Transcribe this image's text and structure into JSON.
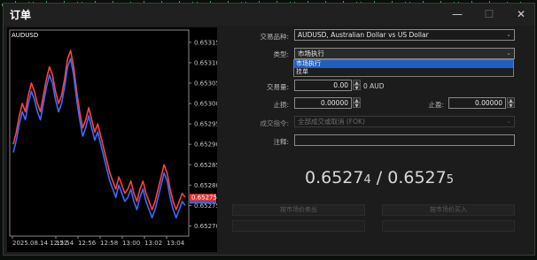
{
  "window": {
    "title": "订单",
    "minimize_icon": "minimize-icon",
    "maximize_icon": "maximize-icon",
    "close_icon": "close-icon"
  },
  "chart": {
    "symbol": "AUDUSD",
    "price_ticks": [
      "0.65315",
      "0.65310",
      "0.65305",
      "0.65300",
      "0.65295",
      "0.65290",
      "0.65285",
      "0.65280",
      "0.65275",
      "0.65270"
    ],
    "current_price_label": "0.65275",
    "time_ticks": [
      "2025.08.14 12:52",
      "12:54",
      "12:56",
      "12:58",
      "13:00",
      "13:02",
      "13:04"
    ],
    "colors": {
      "bid_line": "#ff4040",
      "ask_line": "#3a6cff",
      "grid": "#3a3a3a",
      "current_bg": "#e83030",
      "ask_bg": "#2a6ae0"
    },
    "chart_data": {
      "type": "line",
      "xlabel": "",
      "ylabel": "",
      "ylim": [
        0.652675,
        0.65318
      ],
      "series": [
        {
          "values": [
            0.6529,
            0.65293,
            0.65297,
            0.653,
            0.65298,
            0.65302,
            0.65305,
            0.65303,
            0.653,
            0.65298,
            0.65302,
            0.65306,
            0.65309,
            0.65307,
            0.65303,
            0.653,
            0.65302,
            0.65306,
            0.65311,
            0.65313,
            0.65309,
            0.65303,
            0.65298,
            0.65294,
            0.65296,
            0.65299,
            0.65296,
            0.65293,
            0.65295,
            0.65292,
            0.65289,
            0.65286,
            0.65283,
            0.65281,
            0.65279,
            0.65282,
            0.6528,
            0.65278,
            0.65279,
            0.65281,
            0.65278,
            0.65276,
            0.65279,
            0.65281,
            0.65278,
            0.65276,
            0.65274,
            0.65276,
            0.65279,
            0.65282,
            0.65285,
            0.65283,
            0.65279,
            0.65276,
            0.65274,
            0.65276,
            0.65278,
            0.65277
          ]
        },
        {
          "values": [
            0.65288,
            0.65291,
            0.65295,
            0.65298,
            0.65296,
            0.653,
            0.65303,
            0.65301,
            0.65298,
            0.65296,
            0.653,
            0.65304,
            0.65307,
            0.65305,
            0.65301,
            0.65298,
            0.653,
            0.65304,
            0.65309,
            0.65311,
            0.65307,
            0.65301,
            0.65296,
            0.65292,
            0.65294,
            0.65297,
            0.65294,
            0.65291,
            0.65293,
            0.6529,
            0.65287,
            0.65284,
            0.65281,
            0.65279,
            0.65277,
            0.6528,
            0.65278,
            0.65276,
            0.65277,
            0.65279,
            0.65276,
            0.65274,
            0.65277,
            0.65279,
            0.65276,
            0.65274,
            0.65272,
            0.65274,
            0.65277,
            0.6528,
            0.65283,
            0.65281,
            0.65277,
            0.65274,
            0.65272,
            0.65274,
            0.65276,
            0.65275
          ]
        }
      ]
    }
  },
  "form": {
    "symbol_label": "交易品种:",
    "symbol_value": "AUDUSD, Australian Dollar vs US Dollar",
    "type_label": "类型:",
    "type_value": "市场执行",
    "type_options": [
      "市场执行",
      "挂单"
    ],
    "volume_label": "交易量:",
    "volume_value": "0.00",
    "volume_unit": "0 AUD",
    "stoploss_label": "止损:",
    "stoploss_value": "0.00000",
    "takeprofit_label": "止盈:",
    "takeprofit_value": "0.00000",
    "fill_label": "成交指令:",
    "fill_value": "全部成交或取消 (FOK)",
    "comment_label": "注释:",
    "comment_value": ""
  },
  "quote": {
    "bid_main": "0.6527",
    "bid_last": "4",
    "separator": " / ",
    "ask_main": "0.6527",
    "ask_last": "5"
  },
  "buttons": {
    "sell": "按市场价卖出",
    "buy": "按市场价买入"
  }
}
